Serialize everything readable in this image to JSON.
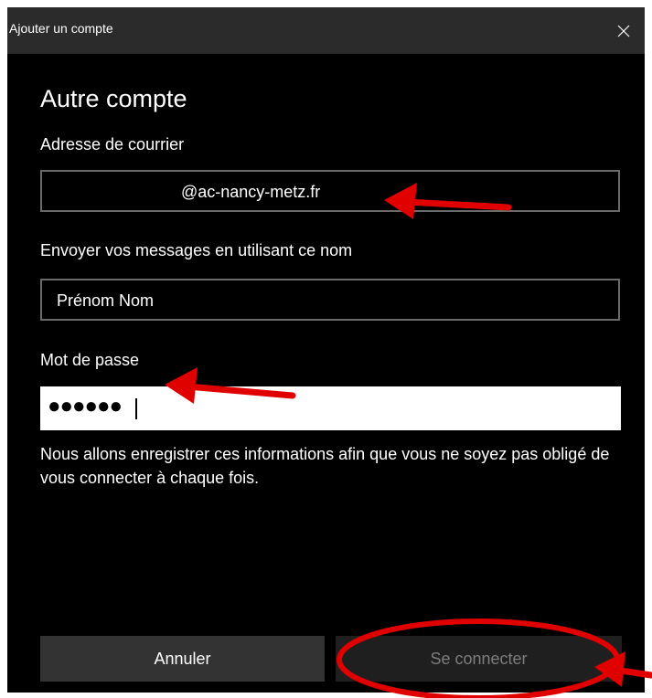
{
  "window": {
    "title": "Ajouter un compte",
    "close_glyph": "✕"
  },
  "form": {
    "heading": "Autre compte",
    "email_label": "Adresse de courrier",
    "email_value": "@ac-nancy-metz.fr",
    "name_label": "Envoyer vos messages en utilisant ce nom",
    "name_value": "Prénom Nom",
    "password_label": "Mot de passe",
    "password_mask": "●●●●●●",
    "info_text": "Nous allons enregistrer ces informations afin que vous ne soyez pas obligé de vous connecter à chaque fois."
  },
  "buttons": {
    "cancel": "Annuler",
    "connect": "Se connecter"
  },
  "icons": {
    "close": "close-icon"
  },
  "colors": {
    "background": "#000000",
    "titlebar": "#2b2b2b",
    "annotation": "#e00000",
    "input_border": "#6a6a6a",
    "disabled_text": "#7d7d7d"
  }
}
